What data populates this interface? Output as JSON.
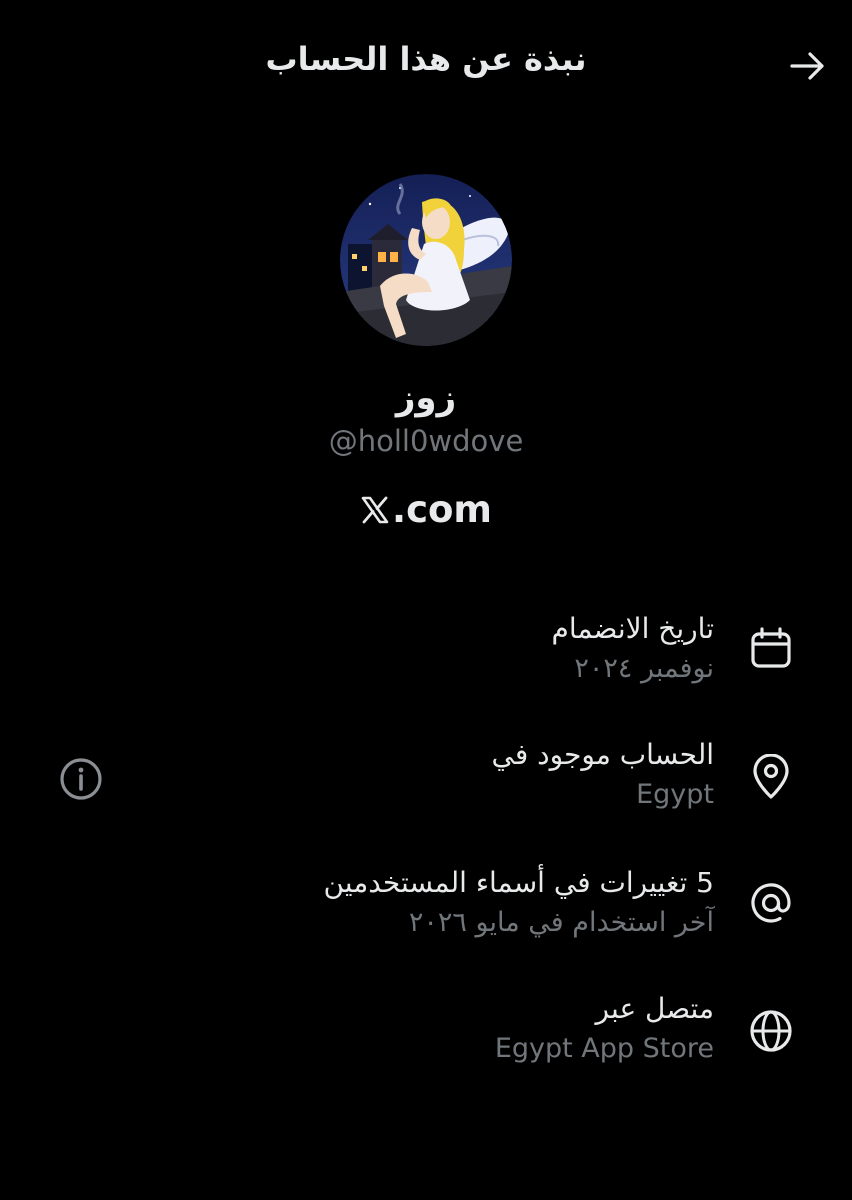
{
  "header": {
    "title": "نبذة عن هذا الحساب",
    "back_icon": "arrow-right-icon"
  },
  "profile": {
    "display_name": "زوز",
    "handle": "@holl0wdove",
    "verified_text": ".com",
    "verified_logo": "X"
  },
  "rows": [
    {
      "icon": "calendar-icon",
      "title": "تاريخ الانضمام",
      "subtitle": "نوفمبر ٢٠٢٤"
    },
    {
      "icon": "location-pin-icon",
      "title": "الحساب موجود في",
      "subtitle": "Egypt"
    },
    {
      "icon": "at-sign-icon",
      "title": "5 تغييرات في أسماء المستخدمين",
      "subtitle": "آخر استخدام في مايو ٢٠٢٦"
    },
    {
      "icon": "globe-icon",
      "title": "متصل عبر",
      "subtitle": "Egypt App Store"
    }
  ],
  "colors": {
    "background": "#000000",
    "primary_text": "#e7e9ea",
    "secondary_text": "#71767b"
  }
}
